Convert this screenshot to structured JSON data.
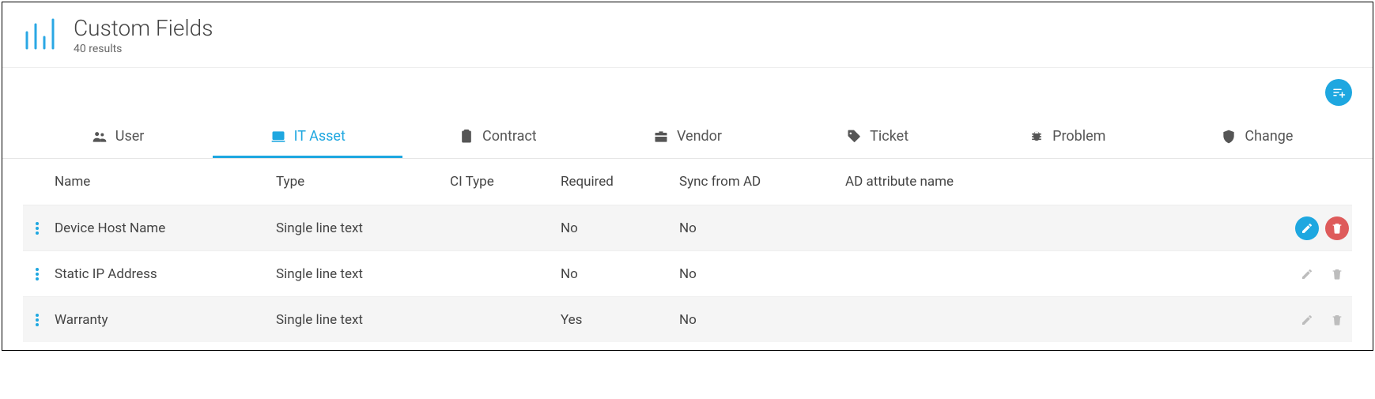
{
  "header": {
    "title": "Custom Fields",
    "subtitle": "40 results"
  },
  "fab": {
    "name": "filter-add"
  },
  "tabs": [
    {
      "id": "user",
      "label": "User",
      "icon": "people-icon",
      "active": false
    },
    {
      "id": "it-asset",
      "label": "IT Asset",
      "icon": "laptop-icon",
      "active": true
    },
    {
      "id": "contract",
      "label": "Contract",
      "icon": "clipboard-icon",
      "active": false
    },
    {
      "id": "vendor",
      "label": "Vendor",
      "icon": "briefcase-icon",
      "active": false
    },
    {
      "id": "ticket",
      "label": "Ticket",
      "icon": "tag-icon",
      "active": false
    },
    {
      "id": "problem",
      "label": "Problem",
      "icon": "bug-icon",
      "active": false
    },
    {
      "id": "change",
      "label": "Change",
      "icon": "shield-icon",
      "active": false
    }
  ],
  "columns": {
    "name": "Name",
    "type": "Type",
    "citype": "CI Type",
    "required": "Required",
    "sync": "Sync from AD",
    "adattr": "AD attribute name"
  },
  "rows": [
    {
      "name": "Device Host Name",
      "type": "Single line text",
      "citype": "",
      "required": "No",
      "sync": "No",
      "adattr": "",
      "highlight": true
    },
    {
      "name": "Static IP Address",
      "type": "Single line text",
      "citype": "",
      "required": "No",
      "sync": "No",
      "adattr": "",
      "highlight": false
    },
    {
      "name": "Warranty",
      "type": "Single line text",
      "citype": "",
      "required": "Yes",
      "sync": "No",
      "adattr": "",
      "highlight": false
    }
  ]
}
